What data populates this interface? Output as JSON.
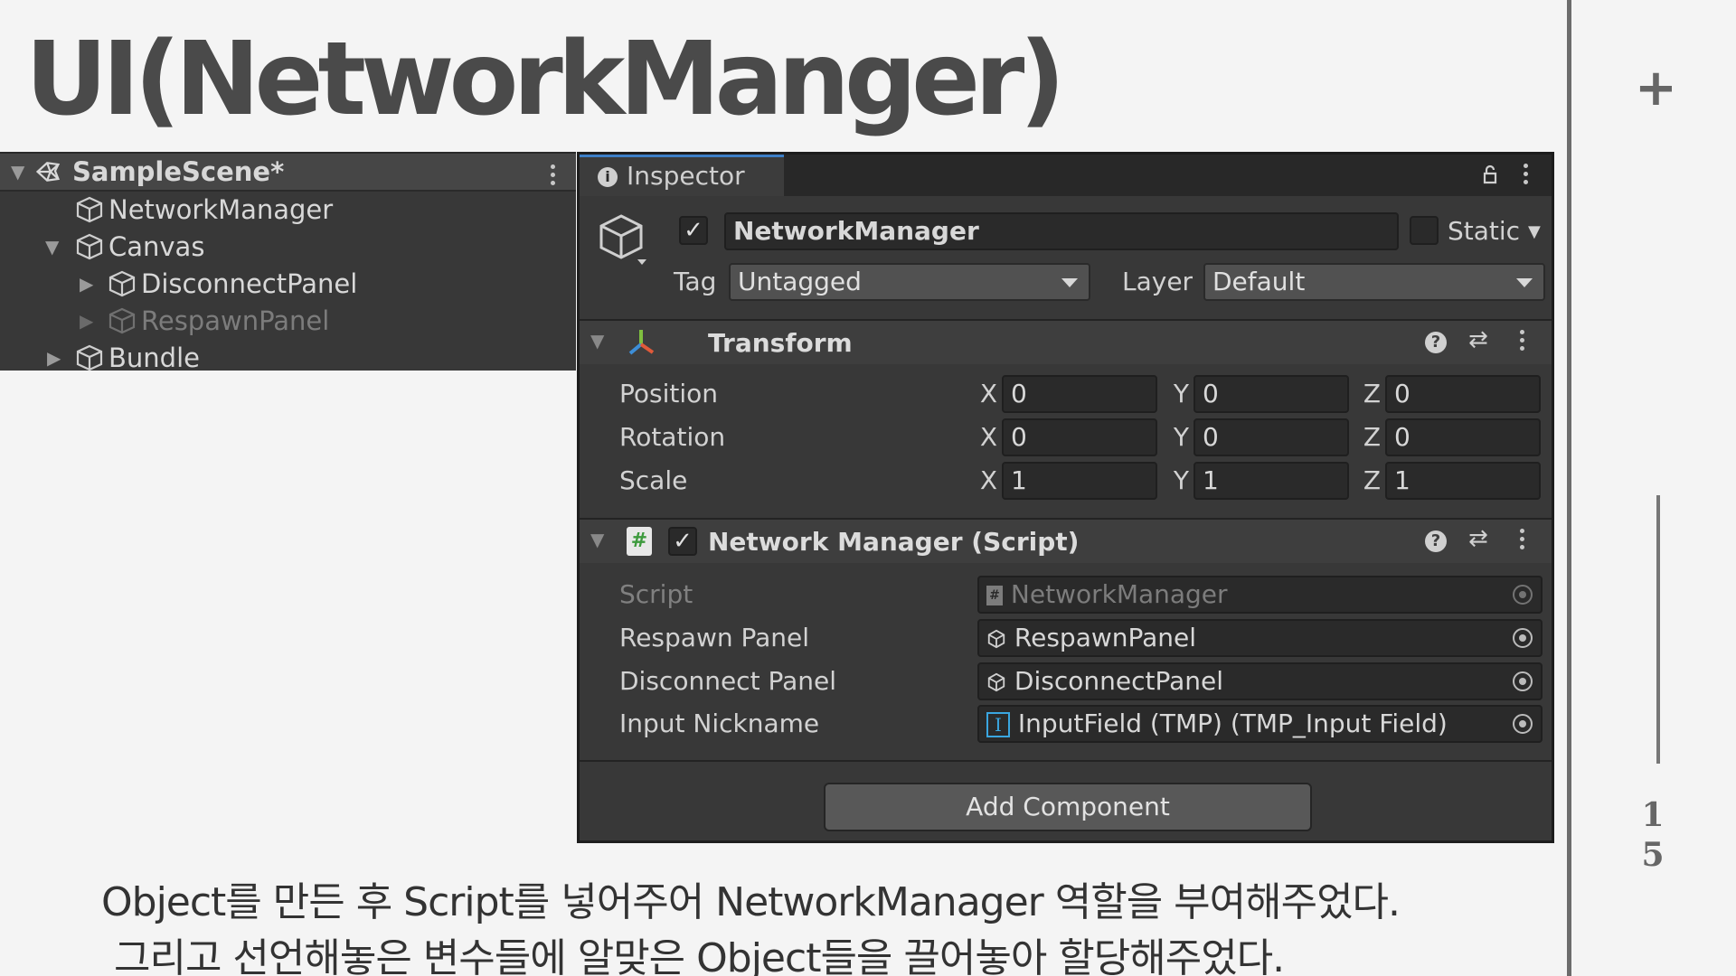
{
  "slide": {
    "title": "UI(NetworkManger)",
    "page_number_top": "1",
    "page_number_bottom": "5",
    "plus": "+"
  },
  "hierarchy": {
    "scene_name": "SampleScene*",
    "items": [
      {
        "label": "NetworkManager"
      },
      {
        "label": "Canvas"
      },
      {
        "label": "DisconnectPanel"
      },
      {
        "label": "RespawnPanel"
      },
      {
        "label": "Bundle"
      }
    ]
  },
  "inspector": {
    "tab_label": "Inspector",
    "object_name": "NetworkManager",
    "static_label": "Static",
    "tag_label": "Tag",
    "tag_value": "Untagged",
    "layer_label": "Layer",
    "layer_value": "Default",
    "transform": {
      "title": "Transform",
      "rows": [
        {
          "label": "Position",
          "x": "0",
          "y": "0",
          "z": "0"
        },
        {
          "label": "Rotation",
          "x": "0",
          "y": "0",
          "z": "0"
        },
        {
          "label": "Scale",
          "x": "1",
          "y": "1",
          "z": "1"
        }
      ],
      "axis_x": "X",
      "axis_y": "Y",
      "axis_z": "Z"
    },
    "script_component": {
      "title": "Network Manager (Script)",
      "rows": [
        {
          "label": "Script",
          "value": "NetworkManager"
        },
        {
          "label": "Respawn Panel",
          "value": "RespawnPanel"
        },
        {
          "label": "Disconnect Panel",
          "value": "DisconnectPanel"
        },
        {
          "label": "Input Nickname",
          "value": "InputField (TMP) (TMP_Input Field)"
        }
      ]
    },
    "add_component_label": "Add Component"
  },
  "caption": {
    "line1": "Object를 만든 후 Script를 넣어주어 NetworkManager 역할을 부여해주었다.",
    "line2": "그리고 선언해놓은 변수들에 알맞은 Object들을 끌어놓아 할당해주었다."
  },
  "colors": {
    "background": "#f4f4f4",
    "panel": "#383838",
    "accent_tab": "#3d7fc7"
  }
}
